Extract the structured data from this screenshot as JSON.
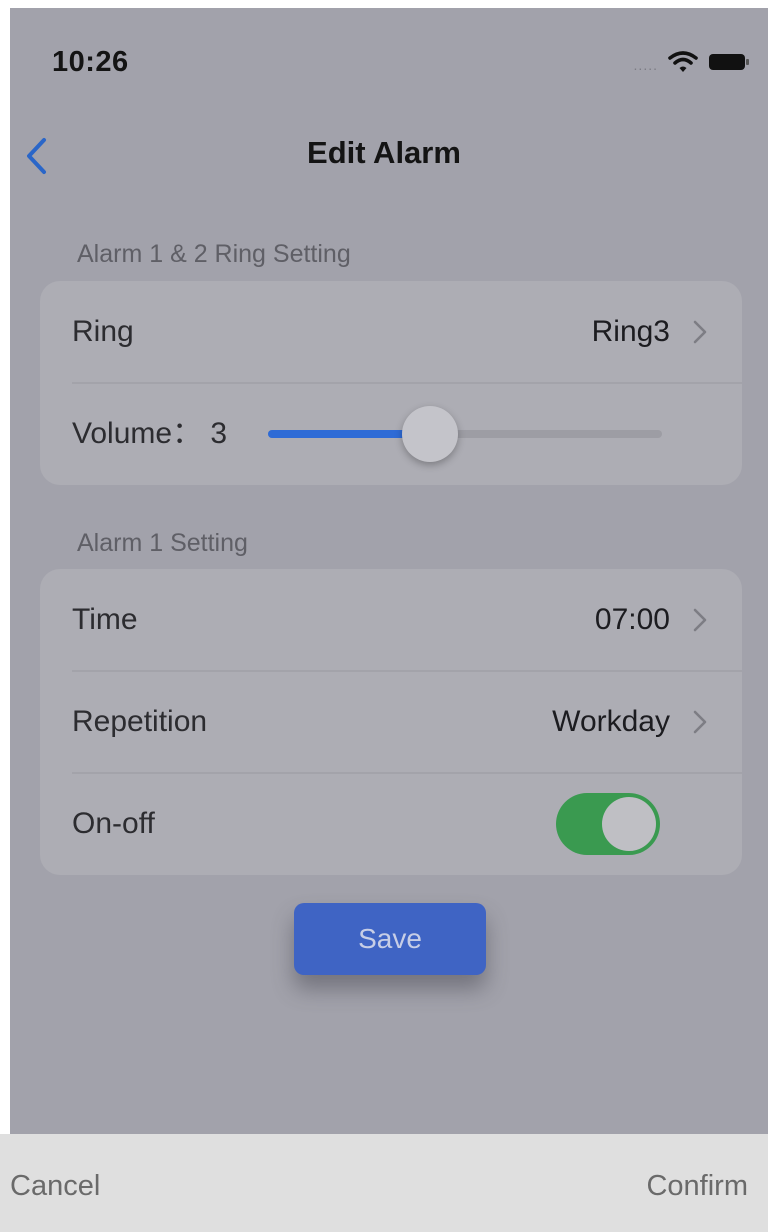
{
  "status_bar": {
    "time": "10:26",
    "signal_dots": "....."
  },
  "nav": {
    "title": "Edit Alarm"
  },
  "ring_section": {
    "header": "Alarm 1 & 2 Ring Setting",
    "ring_label": "Ring",
    "ring_value": "Ring3",
    "volume_label": "Volume：",
    "volume_value": "3",
    "volume_fraction": 0.41
  },
  "alarm1_section": {
    "header": "Alarm 1 Setting",
    "time_label": "Time",
    "time_value": "07:00",
    "repetition_label": "Repetition",
    "repetition_value": "Workday",
    "onoff_label": "On-off",
    "onoff_state": true
  },
  "save_button": {
    "label": "Save"
  },
  "bottom_bar": {
    "cancel_label": "Cancel",
    "confirm_label": "Confirm"
  },
  "colors": {
    "accent_blue": "#2e6bd6",
    "toggle_green": "#3a9a50",
    "save_button": "#3f64c4",
    "overlay_gray": "#a2a2ab"
  },
  "icons": {
    "back": "chevron-left-icon",
    "row_chevron": "chevron-right-icon",
    "wifi": "wifi-icon",
    "battery": "battery-icon"
  }
}
